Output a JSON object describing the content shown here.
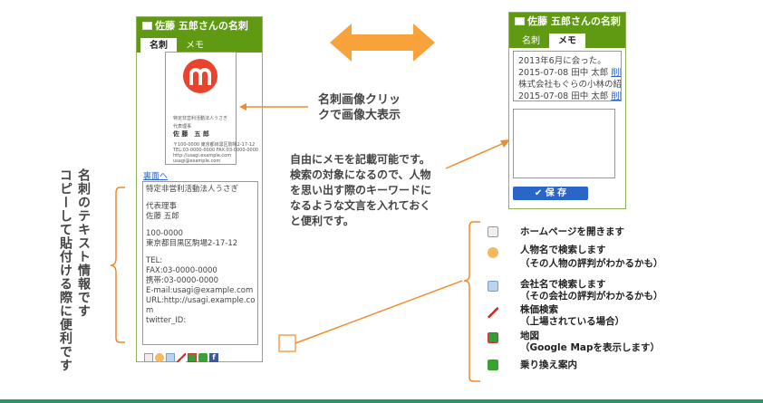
{
  "left_panel": {
    "title": "佐藤 五郎さんの名刺",
    "tabs": [
      "名刺",
      "メモ"
    ],
    "card_image_text": {
      "org": "特定非営利活動法人うさぎ",
      "role": "代表理事",
      "name": "佐 藤　五 郎",
      "small_lines": [
        "〒100-0000 東京都目黒区駒場2-17-12",
        "TEL:03-0000-0000 FAX:03-0000-0000",
        "http://usagi.example.com",
        "usagi@example.com"
      ]
    },
    "back_link": "裏面へ",
    "text_lines": [
      "特定非営利活動法人うさぎ",
      "",
      "代表理事",
      "佐藤 五郎",
      "",
      "100-0000",
      "東京都目黒区駒場2-17-12",
      "",
      "TEL:",
      "FAX:03-0000-0000",
      "携帯:03-0000-0000",
      "E-mail:usagi@example.com",
      "URL:http://usagi.example.co",
      "m",
      "twitter_ID:"
    ]
  },
  "right_panel": {
    "title": "佐藤 五郎さんの名刺",
    "tabs": [
      "名刺",
      "メモ"
    ],
    "memo_entries": [
      {
        "text": "2013年6月に会った。",
        "meta": "",
        "link": ""
      },
      {
        "text": "",
        "meta": "2015-07-08 田中 太郎 ",
        "link": "削除"
      },
      {
        "text": "株式会社もぐらの小林の紹介",
        "meta": "",
        "link": ""
      },
      {
        "text": "",
        "meta": "2015-07-08 田中 太郎 ",
        "link": "削除"
      }
    ],
    "save_button": "✔ 保 存"
  },
  "captions": {
    "image_click": [
      "名刺画像クリッ",
      "クで画像大表示"
    ],
    "memo_desc": [
      "自由にメモを記載可能です。",
      "検索の対象になるので、人物",
      "を思い出す際のキーワードに",
      "なるような文言を入れておく",
      "と便利です。"
    ],
    "vertical_left": [
      "名刺のテキスト情報です",
      "コピーして貼付ける際に便利です"
    ]
  },
  "legend": [
    {
      "icon": "homepage-icon",
      "lines": [
        "ホームページを開きます"
      ]
    },
    {
      "icon": "person-search-icon",
      "lines": [
        "人物名で検索します",
        "（その人物の評判がわかるかも）"
      ]
    },
    {
      "icon": "company-search-icon",
      "lines": [
        "会社名で検索します",
        "（その会社の評判がわかるかも）"
      ]
    },
    {
      "icon": "stock-chart-icon",
      "lines": [
        "株価検索",
        "（上場されている場合）"
      ]
    },
    {
      "icon": "map-icon",
      "lines": [
        "地図",
        "（Google Mapを表示します）"
      ]
    },
    {
      "icon": "train-icon",
      "lines": [
        "乗り換え案内"
      ]
    }
  ],
  "colors": {
    "header_green": "#5f9a12",
    "arrow_orange": "#f7a23b",
    "line_orange": "#f08a2a",
    "accent_blue": "#2a65c8"
  }
}
